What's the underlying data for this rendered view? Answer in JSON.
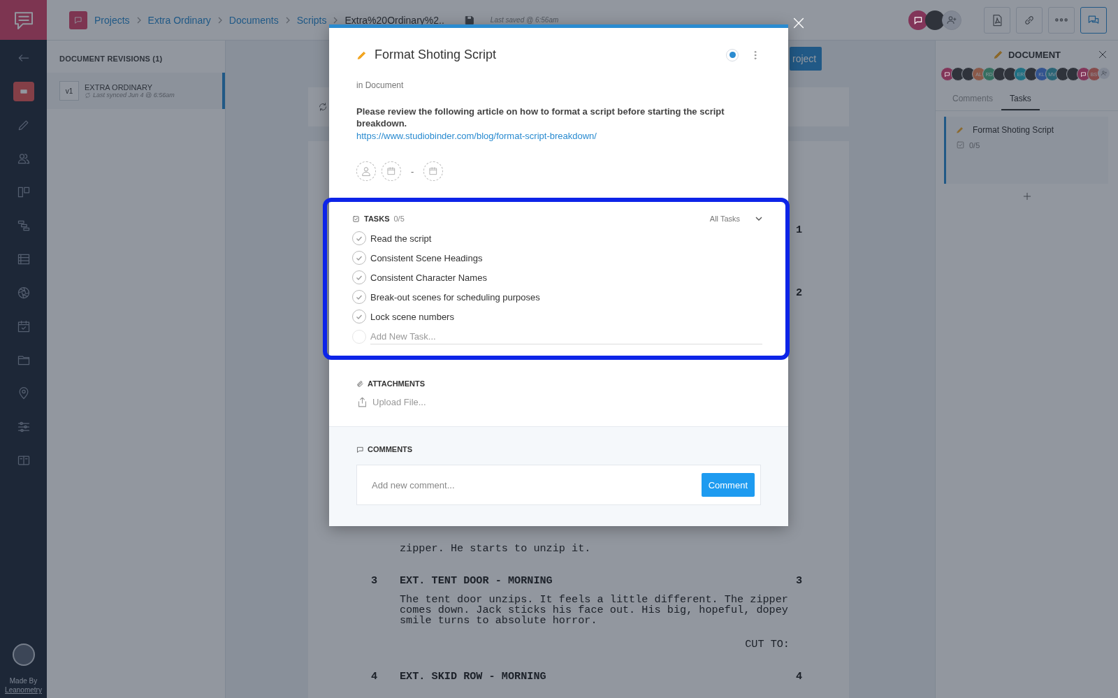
{
  "nav": {
    "items": [
      {
        "kind": "back",
        "selected": false
      },
      {
        "kind": "document",
        "selected": true
      },
      {
        "kind": "pencil",
        "selected": false
      },
      {
        "kind": "people",
        "selected": false
      },
      {
        "kind": "board",
        "selected": false
      },
      {
        "kind": "gantt",
        "selected": false
      },
      {
        "kind": "list",
        "selected": false
      },
      {
        "kind": "aperture",
        "selected": false
      },
      {
        "kind": "calendar",
        "selected": false
      },
      {
        "kind": "folder",
        "selected": false
      },
      {
        "kind": "pin",
        "selected": false
      },
      {
        "kind": "sliders",
        "selected": false
      },
      {
        "kind": "book",
        "selected": false
      }
    ],
    "footer_line_1": "Made By",
    "footer_line_2": "Leanometry"
  },
  "header": {
    "breadcrumbs": [
      {
        "label": "Projects",
        "kind": "link"
      },
      {
        "label": "Extra Ordinary",
        "kind": "link"
      },
      {
        "label": "Documents",
        "kind": "link"
      },
      {
        "label": "Scripts",
        "kind": "link"
      },
      {
        "label": "Extra%20Ordinary%2..",
        "kind": "current"
      }
    ],
    "last_saved": "Last saved @ 6:56am",
    "toolbar": [
      {
        "kind": "pdf",
        "selected": false
      },
      {
        "kind": "link",
        "selected": false
      },
      {
        "kind": "more",
        "selected": false
      },
      {
        "kind": "chat",
        "selected": true
      }
    ],
    "avatars": [
      {
        "kind": "logo",
        "color": "#823559"
      },
      {
        "kind": "photo"
      },
      {
        "kind": "add"
      }
    ]
  },
  "revisions": {
    "title": "DOCUMENT REVISIONS (1)",
    "items": [
      {
        "version": "v1",
        "name": "EXTRA ORDINARY",
        "synced": "Last synced Jun 4 @ 6:56am",
        "selected": true
      }
    ]
  },
  "script": {
    "action_button": "roject",
    "blocks": [
      {
        "kind": "mark",
        "right_number": "1"
      },
      {
        "kind": "mark",
        "right_number": "2"
      },
      {
        "kind": "action",
        "text": "zipper. He starts to unzip it."
      },
      {
        "kind": "heading",
        "number": "3",
        "text": "EXT. TENT DOOR - MORNING",
        "right_number": "3"
      },
      {
        "kind": "action",
        "text": "The tent door unzips. It feels a little different. The zipper\ncomes down. Jack sticks his face out. His big, hopeful, dopey\nsmile turns to absolute horror."
      },
      {
        "kind": "transition",
        "text": "CUT TO:"
      },
      {
        "kind": "heading",
        "number": "4",
        "text": "EXT. SKID ROW - MORNING",
        "right_number": "4"
      }
    ]
  },
  "right_panel": {
    "title": "DOCUMENT",
    "avatars": [
      {
        "kind": "logo",
        "color": "#823559"
      },
      {
        "kind": "photo"
      },
      {
        "kind": "photo"
      },
      {
        "kind": "initials",
        "initials": "AL",
        "color": "#8a5949"
      },
      {
        "kind": "initials",
        "initials": "RD",
        "color": "#356e5f"
      },
      {
        "kind": "photo"
      },
      {
        "kind": "photo"
      },
      {
        "kind": "initials",
        "initials": "ER",
        "color": "#207083"
      },
      {
        "kind": "photo"
      },
      {
        "kind": "initials",
        "initials": "KL",
        "color": "#32538f"
      },
      {
        "kind": "initials",
        "initials": "MV",
        "color": "#2a6475"
      },
      {
        "kind": "photo"
      },
      {
        "kind": "photo"
      },
      {
        "kind": "logo",
        "color": "#823559"
      },
      {
        "kind": "initials",
        "initials": "BS",
        "color": "#854b4b"
      },
      {
        "kind": "add"
      }
    ],
    "tabs": [
      {
        "label": "Comments",
        "selected": false
      },
      {
        "label": "Tasks",
        "selected": true
      }
    ],
    "task_card": {
      "title": "Format Shoting Script",
      "progress": "0/5"
    }
  },
  "modal": {
    "title": "Format Shoting Script",
    "location": "in Document",
    "description": "Please review the following article on how to format a script before starting the script breakdown.",
    "link": "https://www.studiobinder.com/blog/format-script-breakdown/",
    "date_separator": "-",
    "tasks": {
      "title": "TASKS",
      "count": "0/5",
      "filter": "All Tasks",
      "items": [
        {
          "label": "Read the script"
        },
        {
          "label": "Consistent Scene Headings"
        },
        {
          "label": "Consistent Character Names"
        },
        {
          "label": "Break-out scenes for scheduling purposes"
        },
        {
          "label": "Lock scene numbers"
        }
      ],
      "new_placeholder": "Add New Task..."
    },
    "attachments": {
      "title": "ATTACHMENTS",
      "upload": "Upload File..."
    },
    "comments": {
      "title": "COMMENTS",
      "placeholder": "Add new comment...",
      "button": "Comment"
    }
  }
}
